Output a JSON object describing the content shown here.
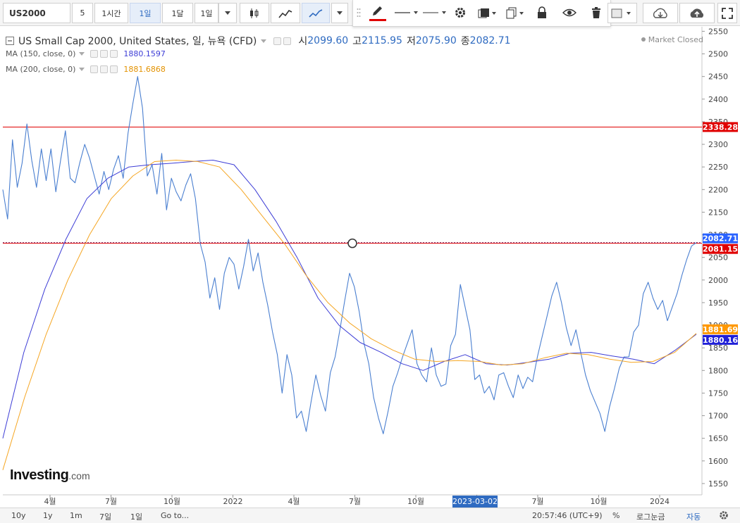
{
  "toolbar": {
    "symbol": "US2000",
    "interval_value": "5",
    "intervals": [
      "1시간",
      "1일",
      "1달",
      "1일"
    ],
    "active_interval_index": 1,
    "icons": [
      "caret-down-icon",
      "candlestick-icon",
      "area-chart-icon",
      "line-chart-icon",
      "caret-down-icon"
    ]
  },
  "drawbar": {
    "icons": [
      "drag-handle-icon",
      "pencil-icon",
      "line-style-icon",
      "line-width-icon",
      "gear-icon",
      "layers-icon",
      "copy-icon",
      "lock-icon",
      "eye-icon",
      "trash-icon",
      "color-box-icon",
      "cloud-download-icon",
      "cloud-upload-icon",
      "fullscreen-icon"
    ]
  },
  "legend": {
    "title": "US Small Cap 2000, United States, 일, 뉴욕 (CFD)",
    "ohlc": [
      {
        "label": "시",
        "value": "2099.60"
      },
      {
        "label": "고",
        "value": "2115.95"
      },
      {
        "label": "저",
        "value": "2075.90"
      },
      {
        "label": "종",
        "value": "2082.71"
      }
    ],
    "ma150": {
      "label": "MA (150, close, 0)",
      "value": "1880.1597"
    },
    "ma200": {
      "label": "MA (200, close, 0)",
      "value": "1881.6868"
    }
  },
  "status": {
    "market": "Market Closed"
  },
  "logo": {
    "name": "Investing",
    "suffix": ".com"
  },
  "colors": {
    "price_line": "#4a7fd0",
    "ma150": "#3d3dd6",
    "ma200": "#f5a623",
    "hline": "#e00000",
    "last_price": "#2962ff",
    "ma200_tag": "#ff9800",
    "ma150_tag": "#1f1fd8"
  },
  "chart_data": {
    "type": "line",
    "y_axis_ticks": [
      1550,
      1600,
      1650,
      1700,
      1750,
      1800,
      1850,
      1900,
      1950,
      2000,
      2050,
      2100,
      2150,
      2200,
      2250,
      2300,
      2350,
      2400,
      2450,
      2500,
      2550
    ],
    "ylim": [
      1525,
      2560
    ],
    "x_axis_labels": [
      "4월",
      "7월",
      "10월",
      "2022",
      "4월",
      "7월",
      "10월",
      "2023",
      "7월",
      "10월",
      "2024"
    ],
    "crosshair_date": "2023-03-02",
    "price_tags": [
      {
        "label": "2338.28",
        "value": 2338.28,
        "role": "hline"
      },
      {
        "label": "2082.71",
        "value": 2082.71,
        "role": "last"
      },
      {
        "label": "2081.15",
        "value": 2081.15,
        "role": "hline"
      },
      {
        "label": "1881.69",
        "value": 1881.69,
        "role": "ma200"
      },
      {
        "label": "1880.16",
        "value": 1880.16,
        "role": "ma150"
      }
    ],
    "horizontal_lines": [
      2338.28,
      2081.15
    ],
    "series": [
      {
        "name": "US Small Cap 2000",
        "values": [
          2200,
          2135,
          2310,
          2205,
          2258,
          2345,
          2265,
          2205,
          2290,
          2220,
          2290,
          2195,
          2265,
          2330,
          2225,
          2215,
          2260,
          2300,
          2270,
          2230,
          2190,
          2240,
          2200,
          2245,
          2275,
          2225,
          2325,
          2390,
          2450,
          2380,
          2230,
          2255,
          2190,
          2280,
          2155,
          2225,
          2195,
          2175,
          2210,
          2235,
          2180,
          2080,
          2040,
          1960,
          2005,
          1935,
          2015,
          2050,
          2035,
          1980,
          2030,
          2090,
          2020,
          2060,
          1995,
          1945,
          1885,
          1835,
          1750,
          1835,
          1790,
          1695,
          1710,
          1665,
          1730,
          1790,
          1745,
          1710,
          1795,
          1830,
          1890,
          1955,
          2015,
          1985,
          1930,
          1860,
          1815,
          1740,
          1695,
          1660,
          1710,
          1765,
          1795,
          1830,
          1860,
          1890,
          1815,
          1790,
          1775,
          1850,
          1790,
          1765,
          1770,
          1855,
          1880,
          1990,
          1940,
          1890,
          1780,
          1790,
          1750,
          1765,
          1735,
          1790,
          1795,
          1765,
          1740,
          1790,
          1760,
          1785,
          1775,
          1830,
          1875,
          1920,
          1965,
          1995,
          1950,
          1895,
          1855,
          1890,
          1840,
          1790,
          1755,
          1730,
          1705,
          1665,
          1720,
          1760,
          1805,
          1830,
          1830,
          1885,
          1900,
          1970,
          1995,
          1960,
          1935,
          1955,
          1910,
          1940,
          1970,
          2010,
          2045,
          2075,
          2082.71
        ]
      },
      {
        "name": "MA (150, close, 0)",
        "values": [
          1650,
          1840,
          1980,
          2090,
          2180,
          2225,
          2250,
          2255,
          2258,
          2262,
          2265,
          2255,
          2200,
          2130,
          2050,
          1960,
          1900,
          1862,
          1840,
          1815,
          1800,
          1820,
          1835,
          1815,
          1812,
          1818,
          1825,
          1838,
          1840,
          1832,
          1825,
          1815,
          1845,
          1880
        ]
      },
      {
        "name": "MA (200, close, 0)",
        "values": [
          1580,
          1740,
          1880,
          2000,
          2100,
          2180,
          2230,
          2262,
          2265,
          2262,
          2250,
          2200,
          2140,
          2080,
          2010,
          1950,
          1905,
          1870,
          1845,
          1825,
          1820,
          1822,
          1820,
          1812,
          1815,
          1828,
          1838,
          1835,
          1825,
          1818,
          1820,
          1840,
          1882
        ]
      }
    ]
  },
  "bottom": {
    "ranges": [
      "10y",
      "1y",
      "1m",
      "7일",
      "1일"
    ],
    "goto": "Go to...",
    "time": "20:57:46 (UTC+9)",
    "percent": "%",
    "log": "로그눈금",
    "auto": "자동"
  }
}
